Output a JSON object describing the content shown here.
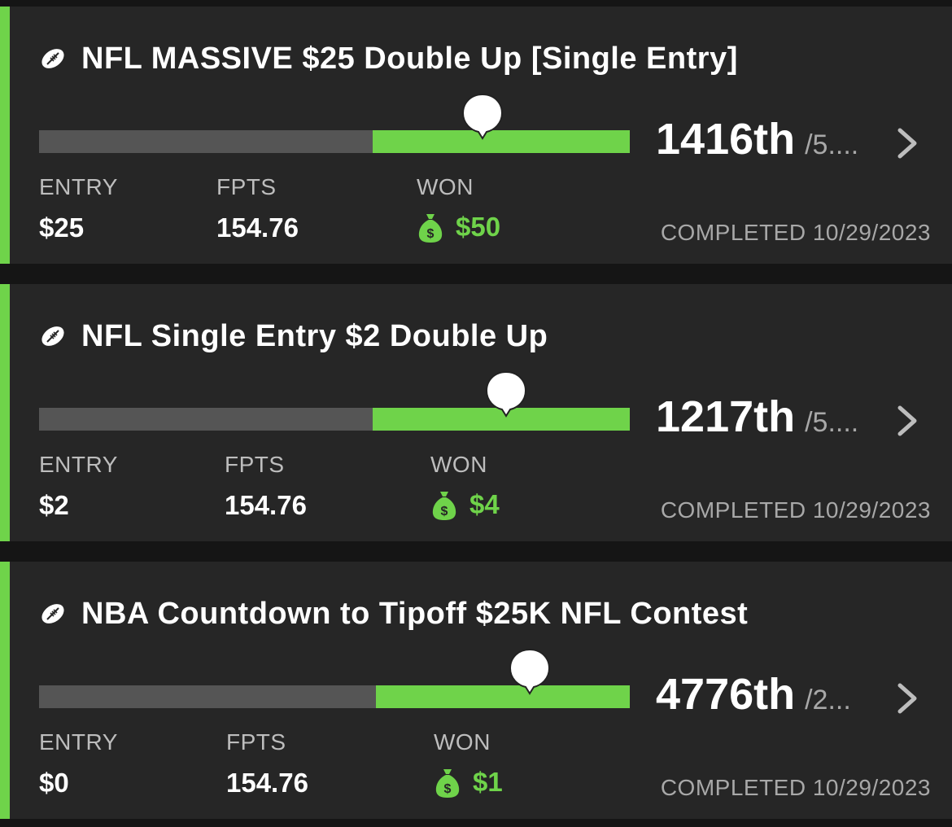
{
  "colors": {
    "background": "#151515",
    "card": "#262626",
    "accent_green": "#6fd34a",
    "track_gray": "#555555",
    "label_gray": "#bdbdbd",
    "muted_gray": "#a8a8a8"
  },
  "icons": {
    "sport": "football-icon",
    "won": "money-bag-icon",
    "nav": "chevron-right-icon",
    "marker": "position-marker-icon"
  },
  "contests": [
    {
      "title": "NFL MASSIVE $25 Double Up [Single Entry]",
      "rank": "1416th",
      "total": "/5....",
      "payout_zone_fraction": 0.435,
      "marker_fraction": 0.75,
      "labels": {
        "entry": "ENTRY",
        "fpts": "FPTS",
        "won": "WON"
      },
      "entry": "$25",
      "fpts": "154.76",
      "won": "$50",
      "completed": "COMPLETED 10/29/2023"
    },
    {
      "title": "NFL Single Entry $2 Double Up",
      "rank": "1217th",
      "total": "/5....",
      "payout_zone_fraction": 0.435,
      "marker_fraction": 0.79,
      "labels": {
        "entry": "ENTRY",
        "fpts": "FPTS",
        "won": "WON"
      },
      "entry": "$2",
      "fpts": "154.76",
      "won": "$4",
      "completed": "COMPLETED 10/29/2023"
    },
    {
      "title": "NBA Countdown to Tipoff $25K NFL Contest",
      "rank": "4776th",
      "total": "/2...",
      "payout_zone_fraction": 0.43,
      "marker_fraction": 0.83,
      "labels": {
        "entry": "ENTRY",
        "fpts": "FPTS",
        "won": "WON"
      },
      "entry": "$0",
      "fpts": "154.76",
      "won": "$1",
      "completed": "COMPLETED 10/29/2023"
    }
  ]
}
